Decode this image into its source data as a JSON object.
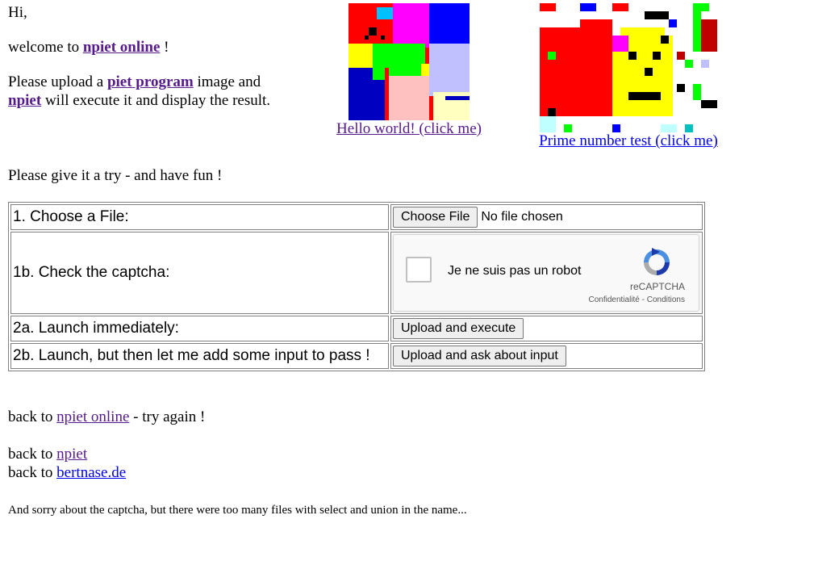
{
  "greeting": {
    "hi": "Hi,",
    "welcome_prefix": "welcome to ",
    "welcome_link": "npiet online",
    "welcome_suffix": " !",
    "upload_prefix": "Please upload a ",
    "upload_link": "piet program",
    "upload_suffix": " image and",
    "exec_link": "npiet",
    "exec_suffix": " will execute it and display the result."
  },
  "examples": {
    "hello": {
      "label": "Hello world! (click me)"
    },
    "prime": {
      "label": "Prime number test (click me)"
    }
  },
  "try_text": "Please give it a try - and have fun !",
  "form": {
    "rows": [
      {
        "label": "1. Choose a File:"
      },
      {
        "label": "1b. Check the captcha:"
      },
      {
        "label": "2a. Launch immediately:"
      },
      {
        "label": "2b. Launch, but then let me add some input to pass !"
      }
    ],
    "choose_file_button": "Choose File",
    "no_file_text": "No file chosen",
    "captcha": {
      "text": "Je ne suis pas un robot",
      "brand": "reCAPTCHA",
      "legal": "Confidentialité - Conditions"
    },
    "upload_execute_button": "Upload and execute",
    "upload_input_button": "Upload and ask about input"
  },
  "footer": {
    "back_prefix": "back to ",
    "back_online_link": "npiet online",
    "back_online_suffix": " - try again !",
    "back_npiet_link": "npiet",
    "back_bertnase_link": "bertnase.de",
    "sorry": "And sorry about the captcha, but there were too many files with select and union in the name..."
  },
  "colors": {
    "link": "#0000ee",
    "visited": "#551a8b",
    "border": "#808080"
  }
}
